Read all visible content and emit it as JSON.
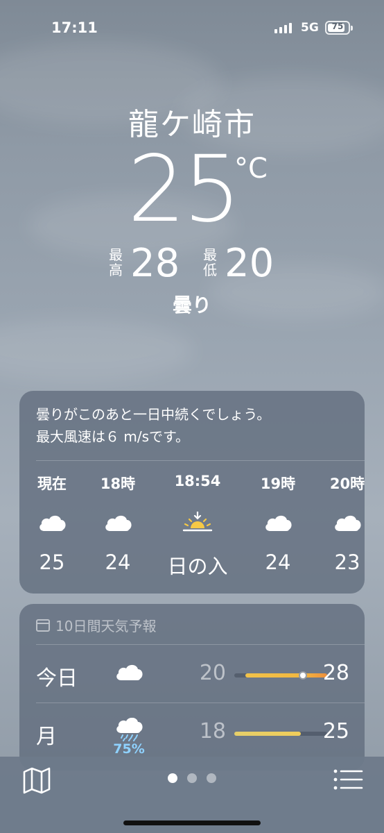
{
  "status_bar": {
    "time": "17:11",
    "network": "5G",
    "battery": "75",
    "battery_level": 0.75
  },
  "header": {
    "city": "龍ケ崎市",
    "temperature": "25",
    "unit": "°C",
    "high_label": "最高",
    "high": "28",
    "low_label": "最低",
    "low": "20",
    "condition": "曇り"
  },
  "hourly": {
    "summary_line1": "曇りがこのあと一日中続くでしょう。",
    "summary_line2": "最大風速は６ m/sです。",
    "items": [
      {
        "label": "現在",
        "icon": "cloud-icon",
        "temp": "25"
      },
      {
        "label": "18時",
        "icon": "cloud-icon",
        "temp": "24"
      },
      {
        "label": "18:54",
        "icon": "sunset-icon",
        "temp": "日の入"
      },
      {
        "label": "19時",
        "icon": "cloud-icon",
        "temp": "24"
      },
      {
        "label": "20時",
        "icon": "cloud-icon",
        "temp": "23"
      }
    ]
  },
  "daily": {
    "header": "10日間天気予報",
    "days": [
      {
        "day": "今日",
        "icon": "cloud-icon",
        "low": "20",
        "high": "28",
        "precip": ""
      },
      {
        "day": "月",
        "icon": "cloud-rain-icon",
        "low": "18",
        "high": "25",
        "precip": "75%"
      }
    ]
  },
  "colors": {
    "card": "#606c7c",
    "bar_warm": "#f1c24a",
    "bar_hot": "#ee8f3c",
    "bar_mild": "#f0cd5a",
    "precip": "#8fd2ff",
    "sun": "#f6c945"
  },
  "bottom_bar": {
    "pages": 3,
    "active_page": 1,
    "left_icon": "map-icon",
    "right_icon": "list-icon"
  }
}
